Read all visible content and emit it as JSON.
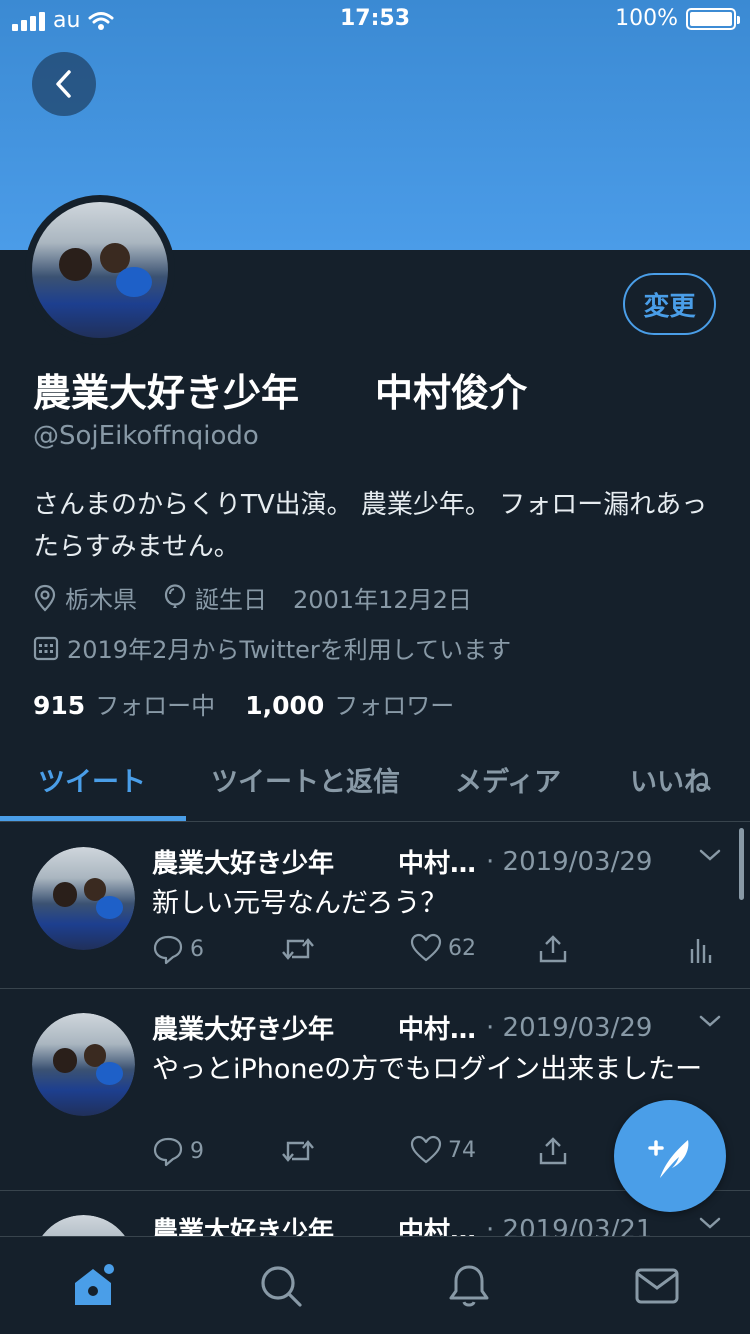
{
  "status_bar": {
    "carrier": "au",
    "time": "17:53",
    "battery": "100%"
  },
  "profile": {
    "edit_label": "変更",
    "name": "農業大好き少年　　中村俊介",
    "handle": "@SojEikoffnqiodo",
    "bio": "さんまのからくりTV出演。 農業少年。 フォロー漏れあったらすみません。",
    "location": "栃木県",
    "birthday_label": "誕生日",
    "birthday": "2001年12月2日",
    "joined": "2019年2月からTwitterを利用しています",
    "following_count": "915",
    "following_label": "フォロー中",
    "followers_count": "1,000",
    "followers_label": "フォロワー"
  },
  "tabs": [
    {
      "label": "ツイート",
      "active": true
    },
    {
      "label": "ツイートと返信",
      "active": false
    },
    {
      "label": "メディア",
      "active": false
    },
    {
      "label": "いいね",
      "active": false
    }
  ],
  "tweets": [
    {
      "name": "農業大好き少年",
      "name2": "中村…",
      "date": "· 2019/03/29",
      "text": "新しい元号なんだろう？",
      "replies": "6",
      "likes": "62"
    },
    {
      "name": "農業大好き少年",
      "name2": "中村…",
      "date": "· 2019/03/29",
      "text": "やっとiPhoneの方でもログイン出来ましたー",
      "replies": "9",
      "likes": "74"
    },
    {
      "name": "農業大好き少年",
      "name2": "中村…",
      "date": "· 2019/03/21",
      "text": "",
      "replies": "",
      "likes": ""
    }
  ],
  "colors": {
    "accent": "#4a9ee8",
    "background": "#15202b",
    "muted": "#8899a6",
    "banner": "#4b9ce8"
  },
  "icons": [
    "back-icon",
    "location-icon",
    "balloon-icon",
    "calendar-icon",
    "reply-icon",
    "retweet-icon",
    "like-icon",
    "share-icon",
    "analytics-icon",
    "chevron-down-icon",
    "compose-icon",
    "home-icon",
    "search-icon",
    "notifications-icon",
    "messages-icon"
  ]
}
